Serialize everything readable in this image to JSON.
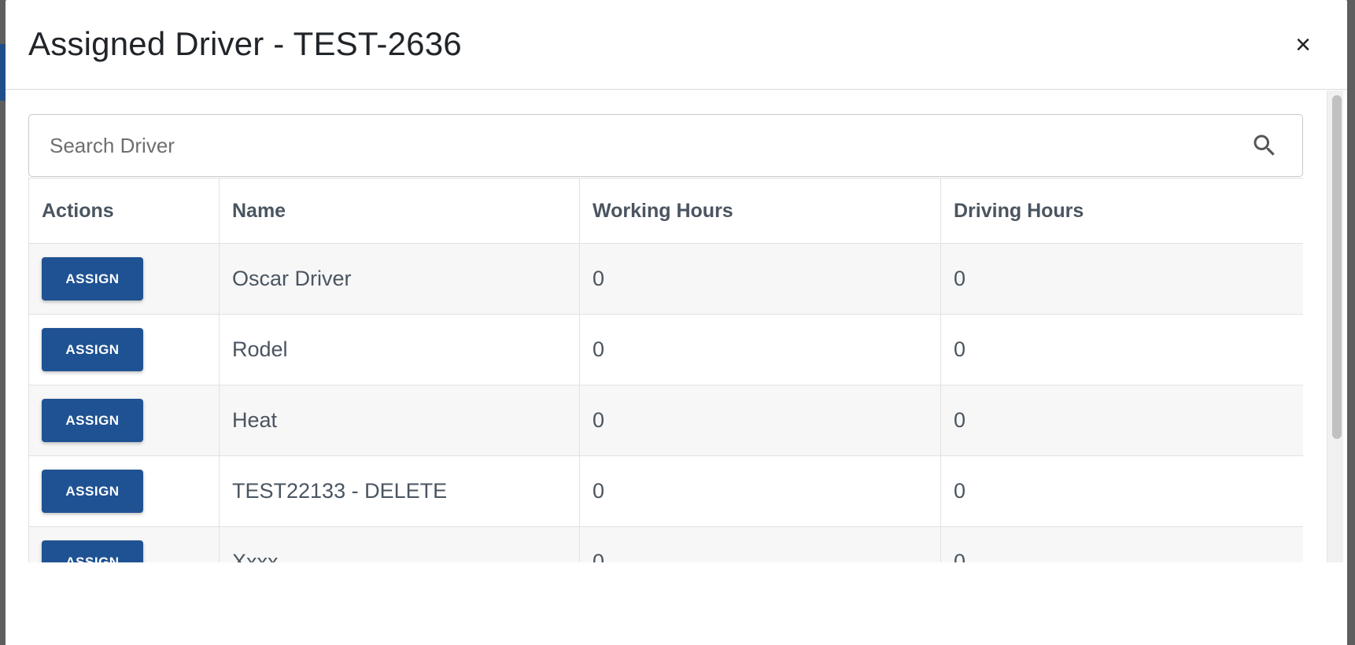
{
  "modal": {
    "title": "Assigned Driver - TEST-2636",
    "close_glyph": "×"
  },
  "search": {
    "placeholder": "Search Driver",
    "value": ""
  },
  "table": {
    "headers": {
      "actions": "Actions",
      "name": "Name",
      "working_hours": "Working Hours",
      "driving_hours": "Driving Hours"
    },
    "rows": [
      {
        "action_label": "ASSIGN",
        "name": "Oscar Driver",
        "working_hours": "0",
        "driving_hours": "0"
      },
      {
        "action_label": "ASSIGN",
        "name": "Rodel",
        "working_hours": "0",
        "driving_hours": "0"
      },
      {
        "action_label": "ASSIGN",
        "name": "Heat",
        "working_hours": "0",
        "driving_hours": "0"
      },
      {
        "action_label": "ASSIGN",
        "name": "TEST22133 - DELETE",
        "working_hours": "0",
        "driving_hours": "0"
      },
      {
        "action_label": "ASSIGN",
        "name": "Xxxx",
        "working_hours": "0",
        "driving_hours": "0"
      }
    ]
  },
  "colors": {
    "primary_button": "#1f5292",
    "header_text": "#4a5561"
  }
}
